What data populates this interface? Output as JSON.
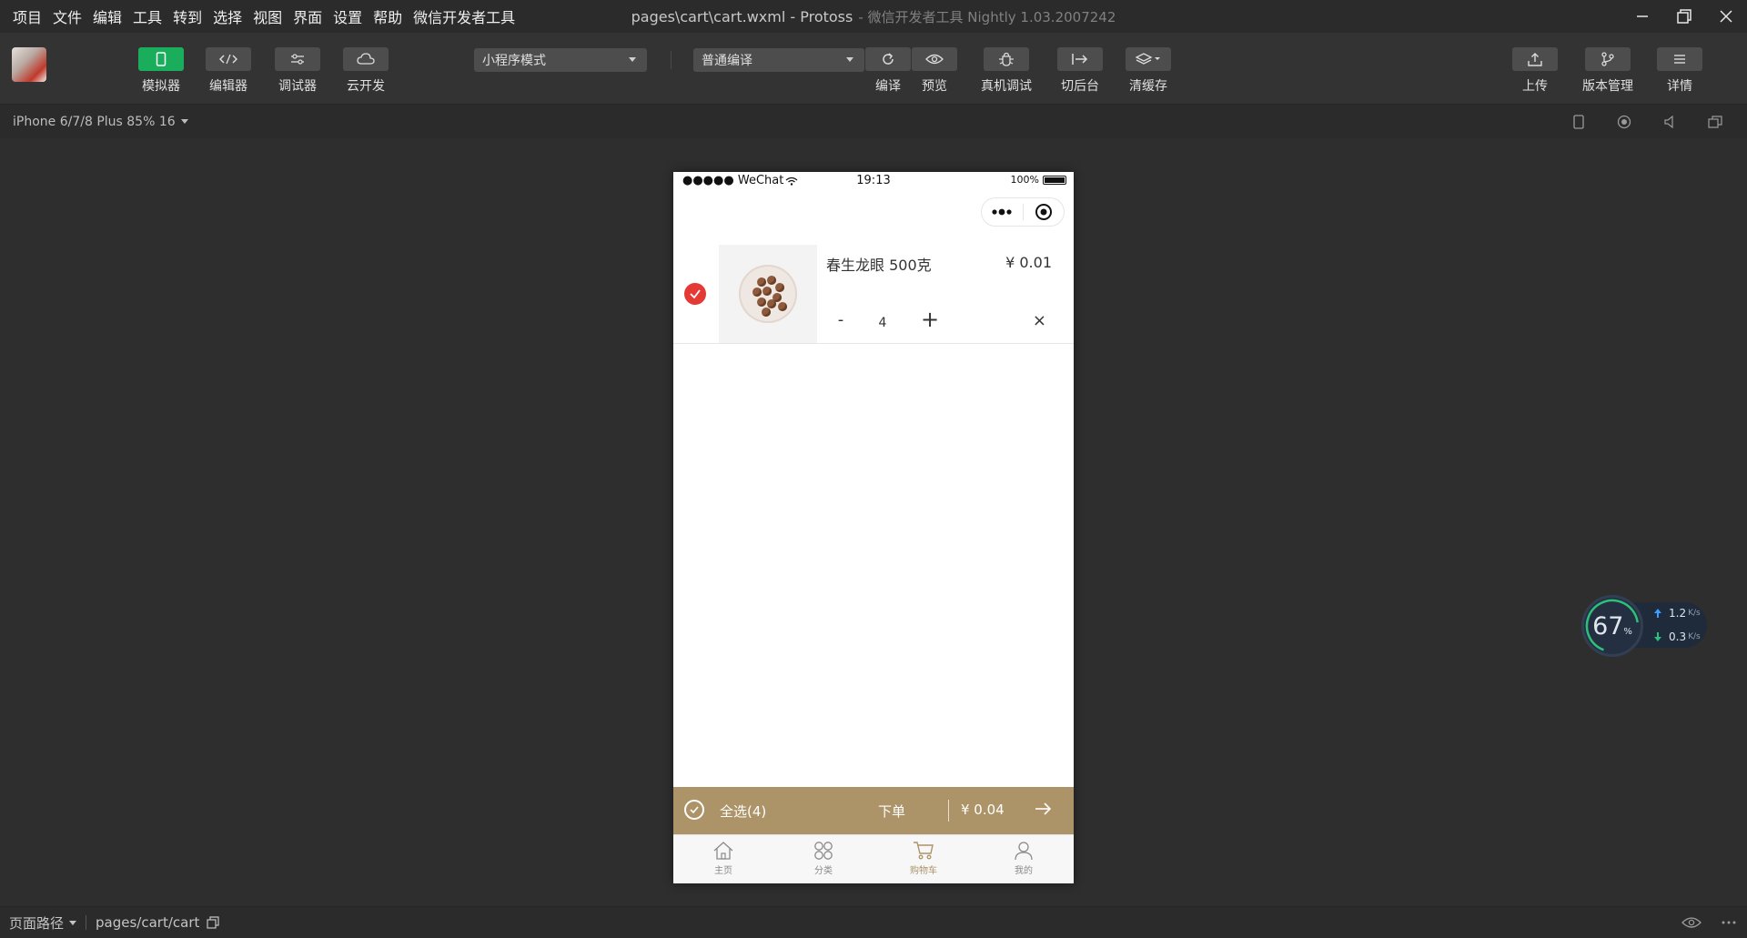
{
  "menu": [
    "项目",
    "文件",
    "编辑",
    "工具",
    "转到",
    "选择",
    "视图",
    "界面",
    "设置",
    "帮助",
    "微信开发者工具"
  ],
  "window": {
    "title": "pages\\cart\\cart.wxml - Protoss",
    "subtitle": "- 微信开发者工具 Nightly 1.03.2007242"
  },
  "toolbar": {
    "simulator_label": "模拟器",
    "editor_label": "编辑器",
    "debugger_label": "调试器",
    "cloud_label": "云开发",
    "mode_select": "小程序模式",
    "compile_select": "普通编译",
    "compile_label": "编译",
    "preview_label": "预览",
    "remote_debug_label": "真机调试",
    "background_label": "切后台",
    "clear_cache_label": "清缓存",
    "upload_label": "上传",
    "version_label": "版本管理",
    "details_label": "详情"
  },
  "device": {
    "label": "iPhone 6/7/8 Plus 85% 16"
  },
  "phone": {
    "status": {
      "carrier": "●●●●● WeChat",
      "time": "19:13",
      "battery": "100%"
    },
    "cart_item": {
      "name": "春生龙眼 500克",
      "price": "¥ 0.01",
      "minus": "-",
      "quantity": "4",
      "plus": "+",
      "delete": "×"
    },
    "checkout": {
      "select_all": "全选(4)",
      "order": "下单",
      "total": "¥ 0.04"
    },
    "tabs": [
      {
        "label": "主页",
        "icon": "home-icon"
      },
      {
        "label": "分类",
        "icon": "category-icon"
      },
      {
        "label": "购物车",
        "icon": "cart-icon"
      },
      {
        "label": "我的",
        "icon": "profile-icon"
      }
    ],
    "active_tab": "购物车",
    "accent_color": "#ad9468",
    "check_color": "#e53935"
  },
  "network": {
    "cpu": "67",
    "pct_sign": "%",
    "up": "1.2",
    "down": "0.3",
    "unit": "K/s"
  },
  "bottom": {
    "path_label": "页面路径",
    "path": "pages/cart/cart"
  }
}
